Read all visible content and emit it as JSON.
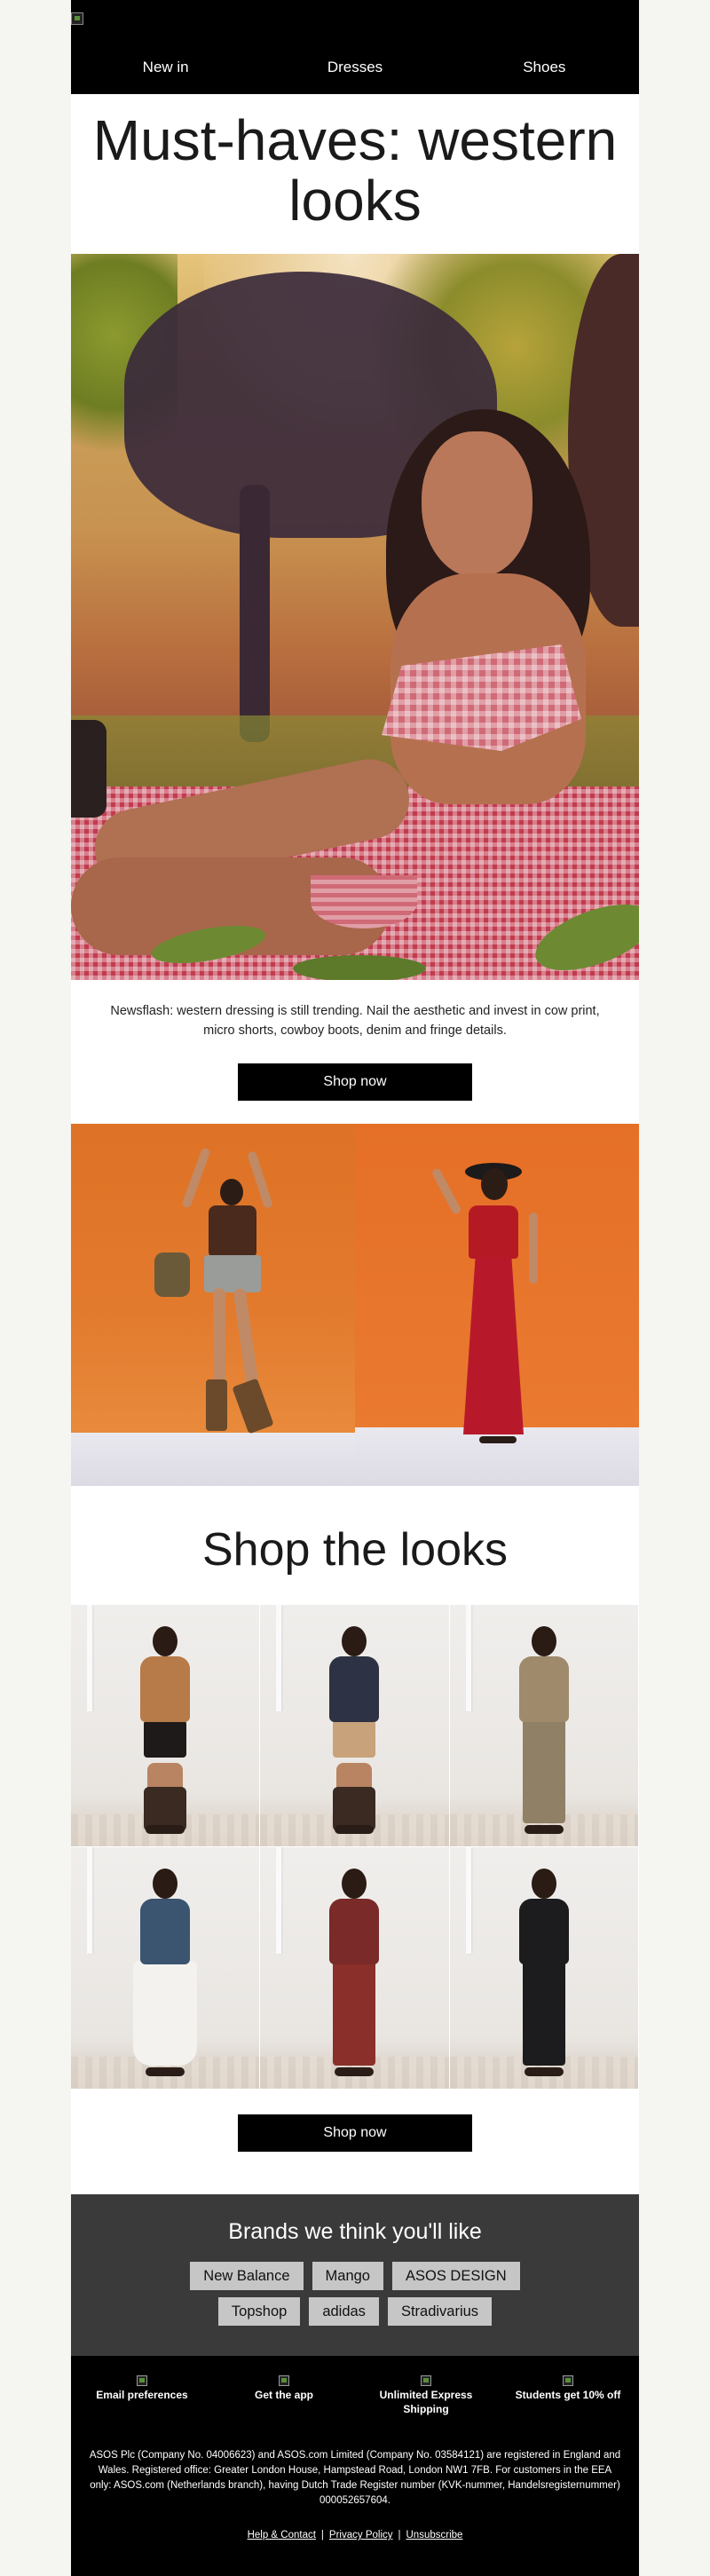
{
  "header": {
    "nav": [
      "New in",
      "Dresses",
      "Shoes"
    ]
  },
  "hero": {
    "title": "Must-haves: western looks",
    "intro": "Newsflash: western dressing is still trending. Nail the aesthetic and invest in cow print, micro shorts, cowboy boots, denim and fringe details.",
    "cta": "Shop now"
  },
  "shop": {
    "title": "Shop the looks",
    "cta": "Shop now",
    "looks": [
      {
        "top": "#b77a49",
        "bottom": "#1d1a19",
        "legs": "boots"
      },
      {
        "top": "#2d3244",
        "bottom": "#c8a27a",
        "legs": "boots"
      },
      {
        "top": "#9f8a6c",
        "bottom": "#8f8066",
        "legs": "long"
      },
      {
        "top": "#3b5470",
        "bottom": "#f4f2ee",
        "legs": "skirt"
      },
      {
        "top": "#7a2a28",
        "bottom": "#8a2f2a",
        "legs": "long"
      },
      {
        "top": "#1c1c1e",
        "bottom": "#1c1c1e",
        "legs": "long"
      }
    ]
  },
  "brands": {
    "title": "Brands we think you'll like",
    "row1": [
      "New Balance",
      "Mango",
      "ASOS DESIGN"
    ],
    "row2": [
      "Topshop",
      "adidas",
      "Stradivarius"
    ]
  },
  "footer": {
    "perks": [
      "Email preferences",
      "Get the app",
      "Unlimited Express Shipping",
      "Students get 10% off"
    ],
    "legal": "ASOS Plc (Company No. 04006623) and ASOS.com Limited (Company No. 03584121) are registered in England and Wales. Registered office: Greater London House, Hampstead Road, London NW1 7FB. For customers in the EEA only: ASOS.com (Netherlands branch), having Dutch Trade Register number (KVK-nummer, Handelsregisternummer) 000052657604.",
    "links": [
      "Help & Contact",
      "Privacy Policy",
      "Unsubscribe"
    ]
  },
  "colors": {
    "header_bg": "#000000",
    "page_bg": "#f5f5f1",
    "brands_bg": "#3a3a3a",
    "chip_bg": "#c6c6c6",
    "button_bg": "#000000"
  }
}
